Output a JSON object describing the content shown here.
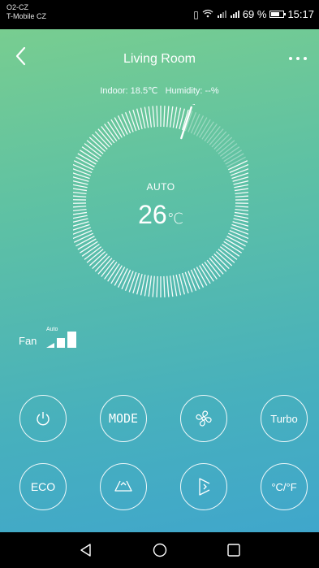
{
  "status_bar": {
    "carrier_line1": "O2-CZ",
    "carrier_line2": "T-Mobile CZ",
    "icons": [
      "vibrate-icon",
      "wifi-icon",
      "signal-icon",
      "signal-icon"
    ],
    "battery": "69 %",
    "time": "15:17"
  },
  "header": {
    "title": "Living Room",
    "back_icon": "chevron-left-icon",
    "more_icon": "more-dots-icon"
  },
  "environment": {
    "indoor_label": "Indoor:",
    "indoor_value": "18.5℃",
    "humidity_label": "Humidity:",
    "humidity_value": "--%"
  },
  "dial": {
    "mode": "AUTO",
    "temperature": "26",
    "unit": "℃",
    "level": 0.05
  },
  "fan": {
    "label": "Fan",
    "speed": "Auto",
    "bars": 3
  },
  "controls": {
    "row1": [
      {
        "name": "power",
        "icon": "power-icon"
      },
      {
        "name": "mode",
        "label": "MODE"
      },
      {
        "name": "fan",
        "icon": "fan-icon"
      },
      {
        "name": "turbo",
        "label": "Turbo"
      }
    ],
    "row2": [
      {
        "name": "eco",
        "label": "ECO"
      },
      {
        "name": "swing-vertical",
        "icon": "swing-vertical-icon"
      },
      {
        "name": "swing-horizontal",
        "icon": "swing-horizontal-icon"
      },
      {
        "name": "unit-toggle",
        "label": "°C/°F"
      }
    ]
  },
  "nav": [
    "back-triangle-icon",
    "home-circle-icon",
    "recents-square-icon"
  ],
  "colors": {
    "gradient_top": "#7ccf8d",
    "gradient_bottom": "#3ea4cf",
    "white": "#ffffff"
  }
}
